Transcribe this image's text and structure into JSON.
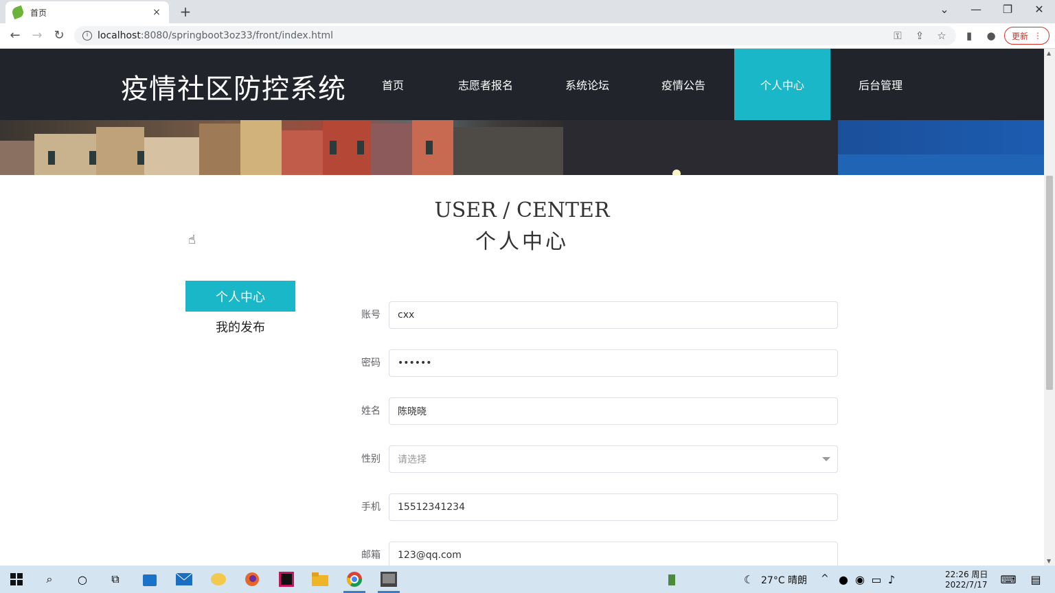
{
  "browser": {
    "tab_title": "首页",
    "tab_close": "×",
    "new_tab": "+",
    "url_host": "localhost",
    "url_rest": ":8080/springboot3oz33/front/index.html",
    "update_label": "更新"
  },
  "site": {
    "brand": "疫情社区防控系统",
    "nav": [
      {
        "label": "首页"
      },
      {
        "label": "志愿者报名"
      },
      {
        "label": "系统论坛"
      },
      {
        "label": "疫情公告"
      },
      {
        "label": "个人中心"
      },
      {
        "label": "后台管理"
      }
    ]
  },
  "page": {
    "heading_en": "USER / CENTER",
    "heading_zh": "个人中心",
    "sidebar": {
      "active": "个人中心",
      "item": "我的发布"
    },
    "form": {
      "account": {
        "label": "账号",
        "value": "cxx"
      },
      "password": {
        "label": "密码",
        "value": "••••••"
      },
      "name": {
        "label": "姓名",
        "value": "陈晓晓"
      },
      "gender": {
        "label": "性别",
        "placeholder": "请选择"
      },
      "phone": {
        "label": "手机",
        "value": "15512341234"
      },
      "email": {
        "label": "邮箱",
        "value": "123@qq.com"
      }
    }
  },
  "taskbar": {
    "weather": "27°C  晴朗",
    "time": "22:26 周日",
    "date": "2022/7/17"
  },
  "colors": {
    "accent": "#1ab7c9",
    "header_bg": "#21242b"
  }
}
